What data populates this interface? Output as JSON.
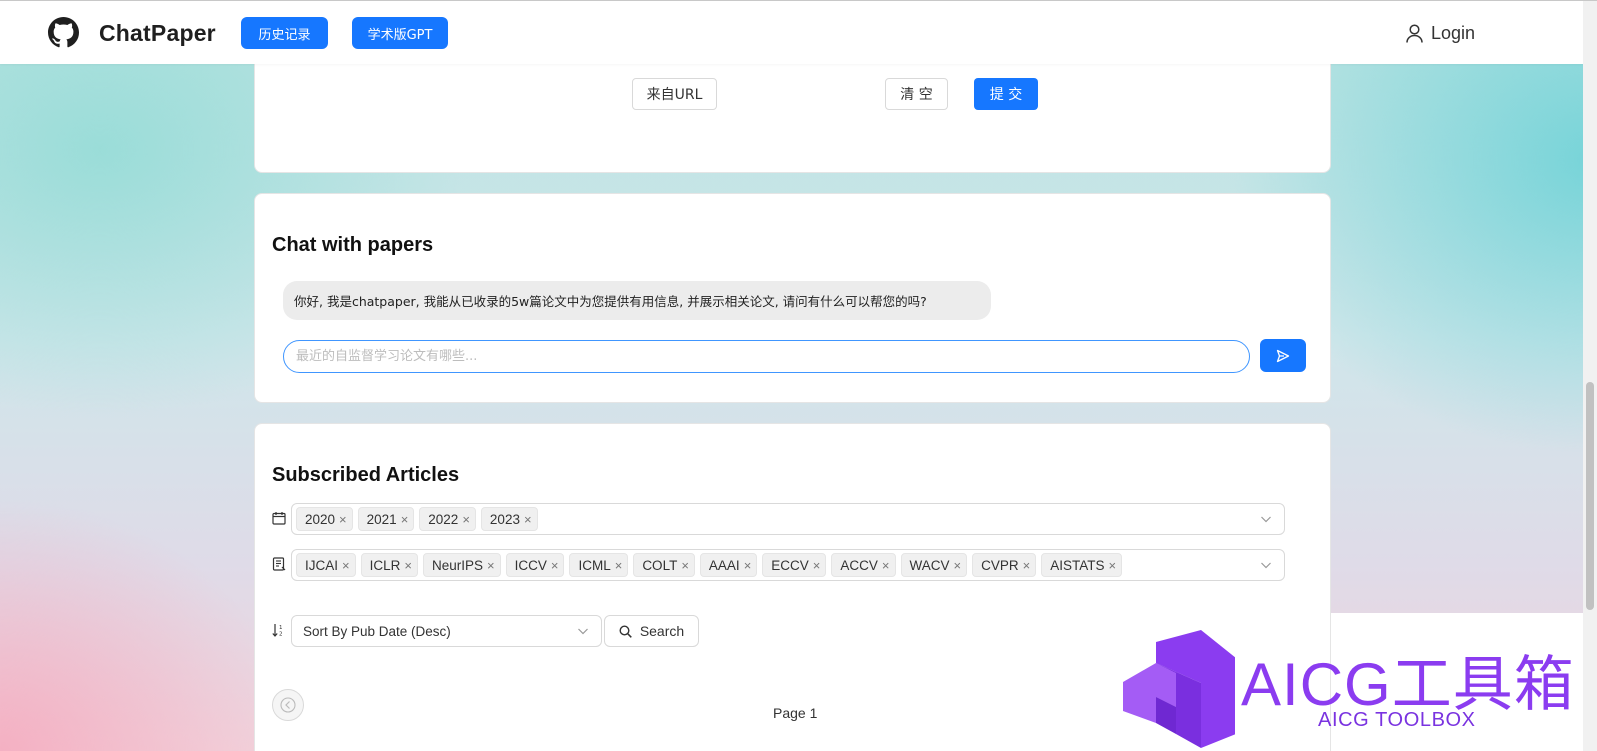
{
  "header": {
    "brand": "ChatPaper",
    "history_button": "历史记录",
    "academic_gpt_button": "学术版GPT",
    "login_label": "Login"
  },
  "upload_card": {
    "from_url_button": "来自URL",
    "clear_button": "清 空",
    "submit_button": "提 交"
  },
  "chat": {
    "title": "Chat with papers",
    "assistant_message": "你好, 我是chatpaper, 我能从已收录的5w篇论文中为您提供有用信息, 并展示相关论文, 请问有什么可以帮您的吗?",
    "input_placeholder": "最近的自监督学习论文有哪些..."
  },
  "subscribed": {
    "title": "Subscribed Articles",
    "years": [
      "2020",
      "2021",
      "2022",
      "2023"
    ],
    "venues": [
      "IJCAI",
      "ICLR",
      "NeurIPS",
      "ICCV",
      "ICML",
      "COLT",
      "AAAI",
      "ECCV",
      "ACCV",
      "WACV",
      "CVPR",
      "AISTATS"
    ],
    "tag_remove_glyph": "×",
    "sort_selected": "Sort By Pub Date (Desc)",
    "search_button": "Search",
    "page_label": "Page 1"
  },
  "watermark": {
    "title": "AICG工具箱",
    "subtitle": "AICG TOOLBOX"
  },
  "colors": {
    "primary": "#1677ff",
    "watermark": "#8b3cf0"
  }
}
